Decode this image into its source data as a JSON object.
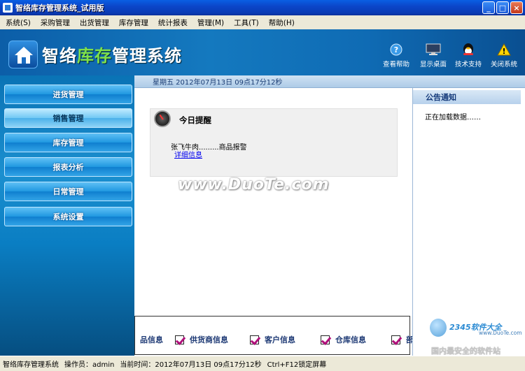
{
  "window": {
    "title": "智络库存管理系统_试用版",
    "buttons": {
      "minimize": "_",
      "maximize": "□",
      "close": "×"
    }
  },
  "menu": [
    "系统(S)",
    "采购管理",
    "出货管理",
    "库存管理",
    "统计报表",
    "管理(M)",
    "工具(T)",
    "帮助(H)"
  ],
  "header": {
    "brand_prefix": "智络",
    "brand_highlight": "库存",
    "brand_suffix": "管理系统",
    "tools": [
      {
        "label": "查看帮助",
        "icon": "help-icon"
      },
      {
        "label": "显示桌面",
        "icon": "monitor-icon"
      },
      {
        "label": "技术支持",
        "icon": "support-icon"
      },
      {
        "label": "关闭系统",
        "icon": "warning-icon"
      }
    ]
  },
  "sidebar": {
    "items": [
      {
        "label": "进货管理",
        "active": false
      },
      {
        "label": "销售管理",
        "active": true
      },
      {
        "label": "库存管理",
        "active": false
      },
      {
        "label": "报表分析",
        "active": false
      },
      {
        "label": "日常管理",
        "active": false
      },
      {
        "label": "系统设置",
        "active": false
      }
    ]
  },
  "datebar": {
    "text": "星期五   2012年07月13日  09点17分12秒"
  },
  "reminder": {
    "title": "今日提醒",
    "item": "张飞牛肉.........商品报警",
    "link": "详细信息"
  },
  "watermark": "www.DuoTe.com",
  "shortcuts": [
    "品信息",
    "供货商信息",
    "客户信息",
    "仓库信息",
    "部"
  ],
  "notice": {
    "title": "公告通知",
    "text": "正在加载数据……"
  },
  "badge": {
    "line1": "2345软件大全",
    "line2": "www.DuoTe.com",
    "line3": "国内最安全的软件站"
  },
  "status": {
    "app": "智络库存管理系统",
    "operator": "操作员：admin",
    "time": "当前时间：2012年07月13日 09点17分12秒",
    "hotkey": "Ctrl+F12锁定屏幕"
  },
  "colors": {
    "accent": "#1479bf",
    "title_bar": "#0b46c9",
    "check": "#b0107a"
  }
}
